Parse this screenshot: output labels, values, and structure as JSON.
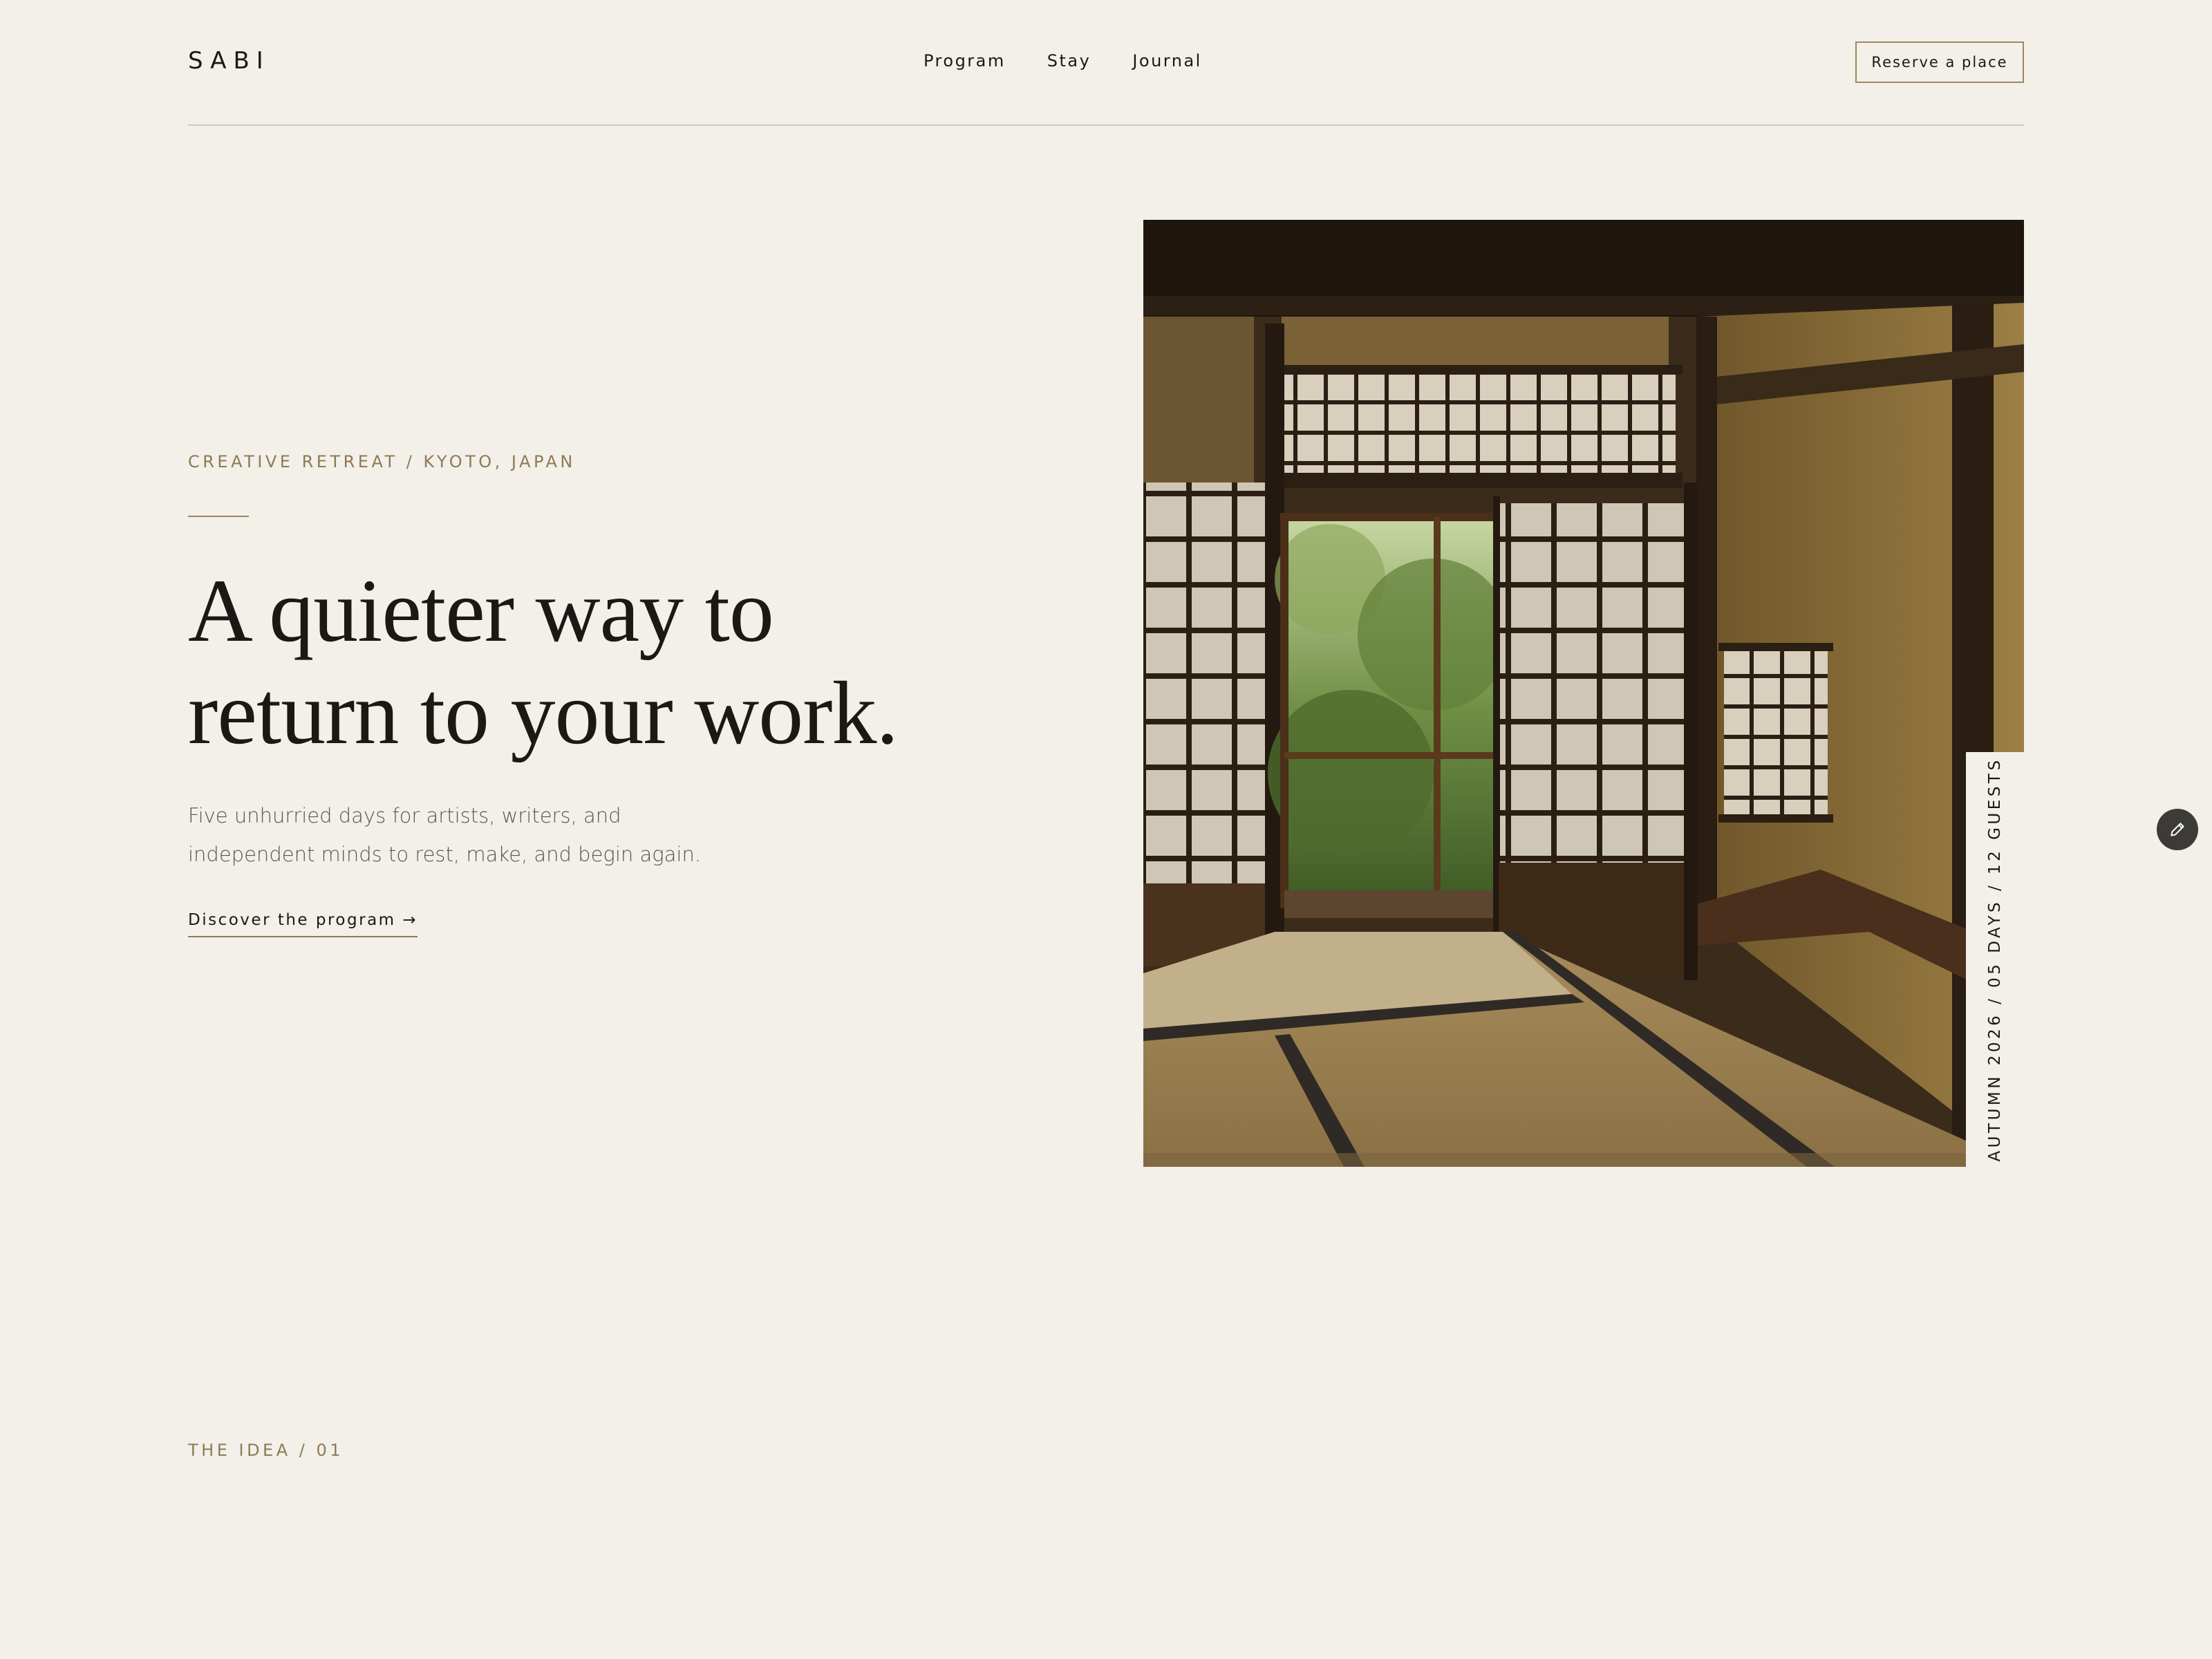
{
  "header": {
    "logo": "SABI",
    "nav": [
      "Program",
      "Stay",
      "Journal"
    ],
    "reserve_label": "Reserve a place"
  },
  "hero": {
    "eyebrow": "CREATIVE RETREAT / KYOTO, JAPAN",
    "headline_line1": "A quieter way to",
    "headline_line2": "return to your work.",
    "intro_line1": "Five unhurried days for artists, writers, and",
    "intro_line2": "independent minds to rest, make, and begin again.",
    "cta_label": "Discover the program →",
    "image_tag": "AUTUMN 2026 / 05 DAYS / 12 GUESTS"
  },
  "section": {
    "label": "THE IDEA / 01"
  },
  "colors": {
    "background": "#f3f0ea",
    "accent": "#8e7a52",
    "ink": "#1b1915"
  },
  "icons": {
    "edit": "pencil-icon"
  }
}
